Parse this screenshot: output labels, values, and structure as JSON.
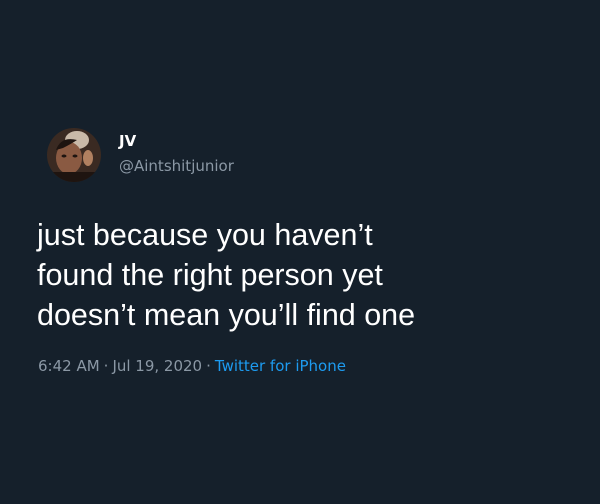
{
  "author": {
    "display_name": "JV",
    "handle": "@Aintshitjunior",
    "avatar_icon": "profile-photo"
  },
  "tweet": {
    "lines": [
      "just because you haven’t",
      "found the right person yet",
      "doesn’t mean you’ll find one"
    ]
  },
  "meta": {
    "time": "6:42 AM",
    "separator": "·",
    "date": "Jul 19, 2020",
    "source": "Twitter for iPhone"
  },
  "colors": {
    "background": "#15202b",
    "primary_text": "#ffffff",
    "secondary_text": "#8b98a5",
    "link": "#1d9bf0"
  }
}
